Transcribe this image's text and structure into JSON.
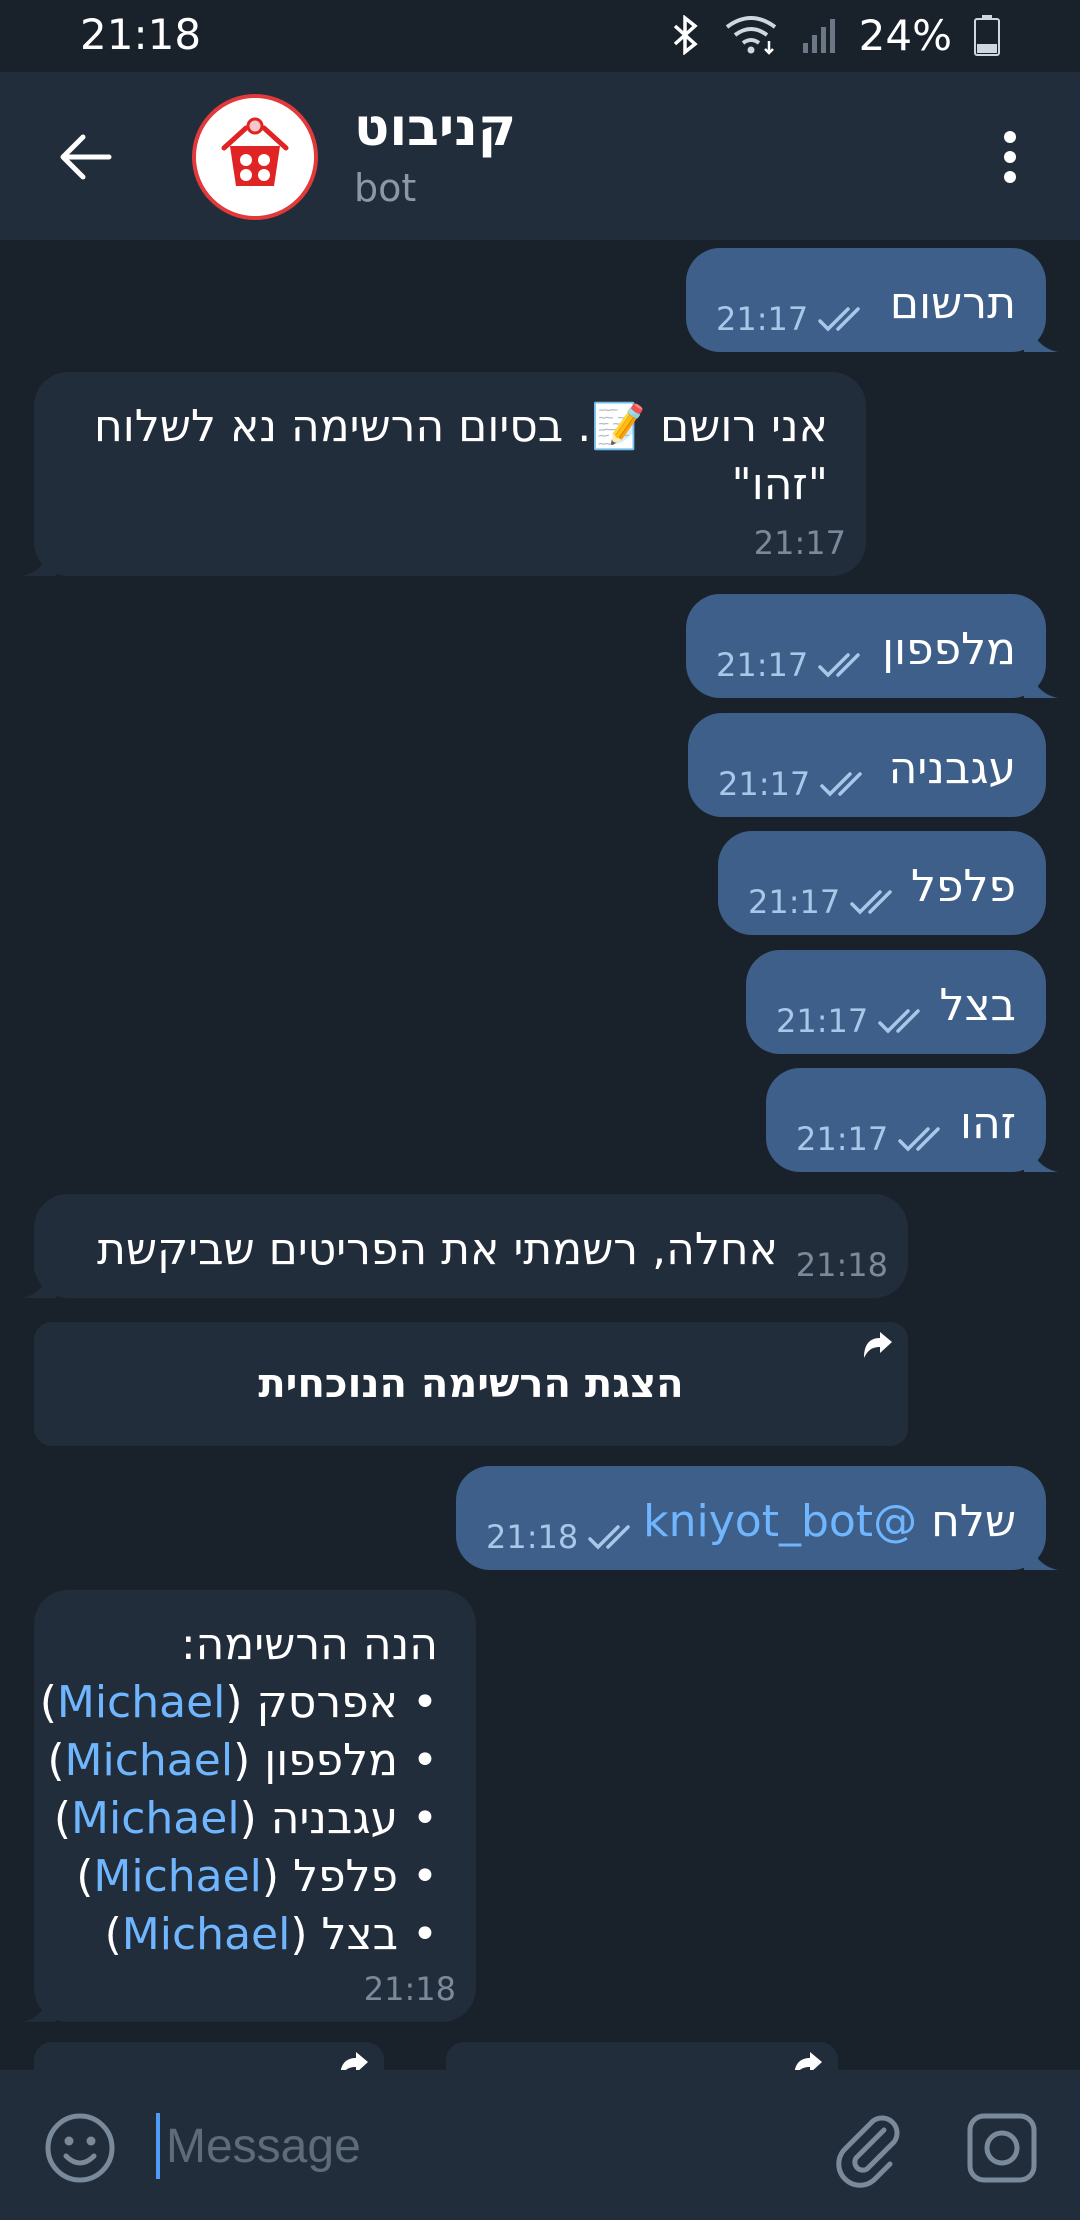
{
  "status_bar": {
    "time": "21:18",
    "battery": "24%"
  },
  "header": {
    "title": "קניבוט",
    "subtitle": "bot"
  },
  "messages": [
    {
      "text": "תרשום",
      "time": "21:17"
    },
    {
      "line1": "אני רושם 📝. בסיום הרשימה נא לשלוח",
      "line2": "\"זהו\"",
      "time": "21:17"
    },
    {
      "text": "מלפפון",
      "time": "21:17"
    },
    {
      "text": "עגבניה",
      "time": "21:17"
    },
    {
      "text": "פלפל",
      "time": "21:17"
    },
    {
      "text": "בצל",
      "time": "21:17"
    },
    {
      "text": "זהו",
      "time": "21:17"
    },
    {
      "text": "אחלה, רשמתי את הפריטים שביקשת",
      "time": "21:18"
    },
    {
      "prefix": "שלח",
      "mention": "@kniyot_bot",
      "time": "21:18"
    },
    {
      "heading": "הנה הרשימה:",
      "items": [
        {
          "bullet": "•",
          "name": "אפרסק",
          "user": "Michael"
        },
        {
          "bullet": "•",
          "name": "מלפפון",
          "user": "Michael"
        },
        {
          "bullet": "•",
          "name": "עגבניה",
          "user": "Michael"
        },
        {
          "bullet": "•",
          "name": "פלפל",
          "user": "Michael"
        },
        {
          "bullet": "•",
          "name": "בצל",
          "user": "Michael"
        }
      ],
      "time": "21:18"
    }
  ],
  "keyboard_button": {
    "label": "הצגת הרשימה הנוכחית"
  },
  "input": {
    "placeholder": "Message"
  }
}
